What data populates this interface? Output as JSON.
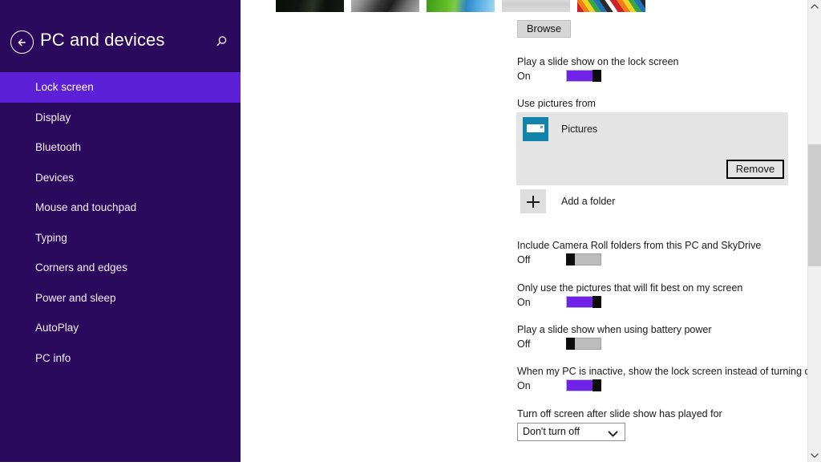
{
  "header": {
    "title": "PC and devices",
    "back_icon": "back-arrow-circle-icon",
    "search_icon": "search-icon"
  },
  "sidebar": {
    "items": [
      {
        "label": "Lock screen",
        "selected": true
      },
      {
        "label": "Display",
        "selected": false
      },
      {
        "label": "Bluetooth",
        "selected": false
      },
      {
        "label": "Devices",
        "selected": false
      },
      {
        "label": "Mouse and touchpad",
        "selected": false
      },
      {
        "label": "Typing",
        "selected": false
      },
      {
        "label": "Corners and edges",
        "selected": false
      },
      {
        "label": "Power and sleep",
        "selected": false
      },
      {
        "label": "AutoPlay",
        "selected": false
      },
      {
        "label": "PC info",
        "selected": false
      }
    ],
    "accent_color": "#5c21d6",
    "background_color": "#2b0a5e"
  },
  "main": {
    "thumbnails": [
      {
        "name": "lock-screen-preview-1",
        "description": "dark green landscape"
      },
      {
        "name": "lock-screen-preview-2",
        "description": "grayscale rock texture"
      },
      {
        "name": "lock-screen-preview-3",
        "description": "green field and blue water"
      },
      {
        "name": "lock-screen-preview-4",
        "description": "light gray speckled texture"
      },
      {
        "name": "lock-screen-preview-5",
        "description": "diagonal rainbow stripes"
      }
    ],
    "browse_label": "Browse",
    "settings": [
      {
        "label": "Play a slide show on the lock screen",
        "state": "On",
        "on": true
      },
      {
        "label": "Include Camera Roll folders from this PC and SkyDrive",
        "state": "Off",
        "on": false
      },
      {
        "label": "Only use the pictures that will fit best on my screen",
        "state": "On",
        "on": true
      },
      {
        "label": "Play a slide show when using battery power",
        "state": "Off",
        "on": false
      },
      {
        "label": "When my PC is inactive, show the lock screen instead of turning off the screen",
        "state": "On",
        "on": true
      }
    ],
    "sources": {
      "label": "Use pictures from",
      "folder_name": "Pictures",
      "folder_icon": "pictures-folder-icon",
      "remove_label": "Remove",
      "add_folder_label": "Add a folder",
      "add_folder_icon": "plus-icon"
    },
    "timeout": {
      "label": "Turn off screen after slide show has played for",
      "value": "Don't turn off",
      "chevron_icon": "chevron-down-icon"
    }
  },
  "scrollbar": {
    "up_icon": "chevron-up-icon",
    "down_icon": "chevron-down-icon"
  },
  "colors": {
    "toggle_on": "#7122e8",
    "toggle_off": "#bdbdbd",
    "header_bg": "#2b0a5e",
    "selected_nav": "#5c21d6"
  }
}
